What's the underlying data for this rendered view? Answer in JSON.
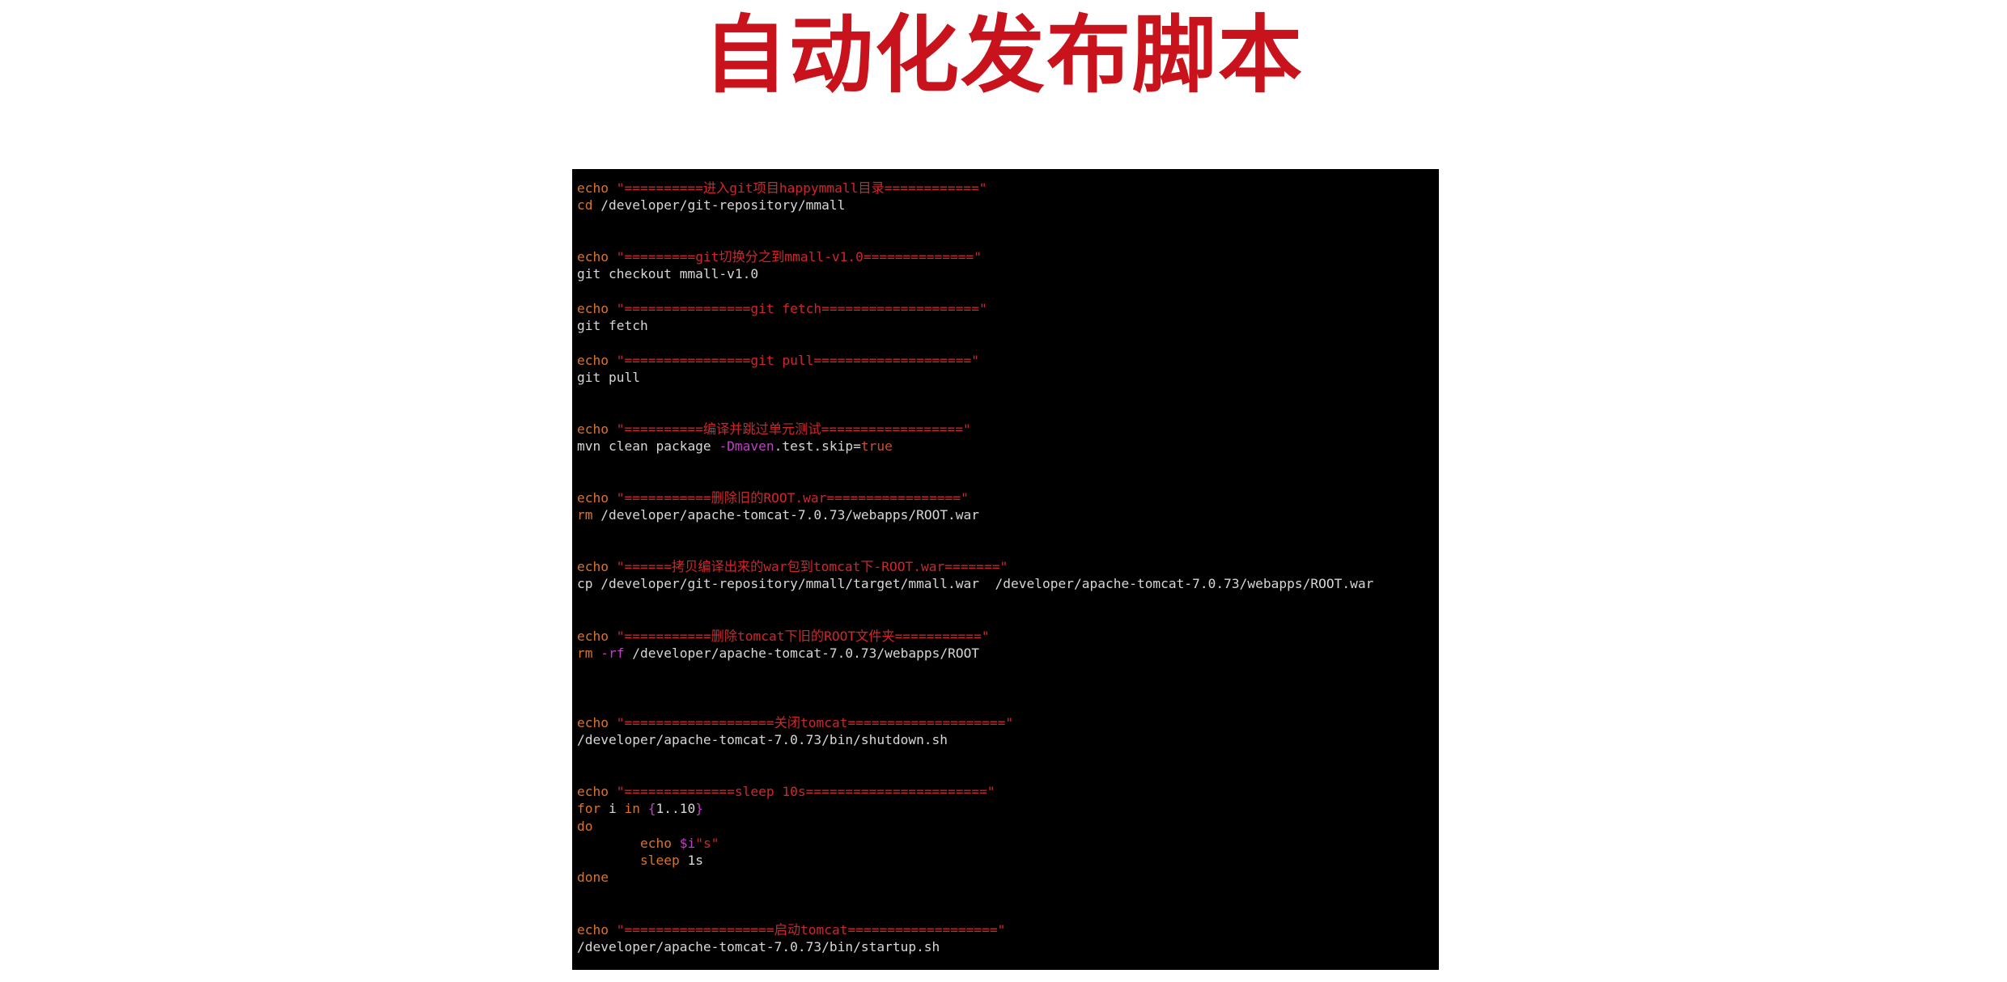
{
  "title": "自动化发布脚本",
  "colors": {
    "title": "#c8131c",
    "terminal_bg": "#000000",
    "plain": "#d6d6d6",
    "keyword": "#d8732c",
    "string": "#d0262b",
    "flag": "#c33ec6",
    "bool": "#c9502e",
    "variable": "#c33ec6"
  },
  "code_lines": [
    [
      {
        "t": "echo ",
        "c": "kw"
      },
      {
        "t": "\"==========进入git项目happymmall目录============\"",
        "c": "str"
      }
    ],
    [
      {
        "t": "cd ",
        "c": "kw"
      },
      {
        "t": "/developer/git-repository/mmall",
        "c": "plain"
      }
    ],
    [
      {
        "t": "echo ",
        "c": "kw"
      },
      {
        "t": "\"=========git切换分之到mmall-v1.0==============\"",
        "c": "str"
      }
    ],
    [
      {
        "t": "git checkout mmall-v1.0",
        "c": "plain"
      }
    ],
    [
      {
        "t": "echo ",
        "c": "kw"
      },
      {
        "t": "\"================git fetch====================\"",
        "c": "str"
      }
    ],
    [
      {
        "t": "git fetch",
        "c": "plain"
      }
    ],
    [
      {
        "t": "echo ",
        "c": "kw"
      },
      {
        "t": "\"================git pull====================\"",
        "c": "str"
      }
    ],
    [
      {
        "t": "git pull",
        "c": "plain"
      }
    ],
    [
      {
        "t": "echo ",
        "c": "kw"
      },
      {
        "t": "\"==========编译并跳过单元测试==================\"",
        "c": "str"
      }
    ],
    [
      {
        "t": "mvn clean package ",
        "c": "plain"
      },
      {
        "t": "-Dmaven",
        "c": "flag"
      },
      {
        "t": ".test.skip=",
        "c": "plain"
      },
      {
        "t": "true",
        "c": "bool"
      }
    ],
    [
      {
        "t": "echo ",
        "c": "kw"
      },
      {
        "t": "\"===========删除旧的ROOT.war=================\"",
        "c": "str"
      }
    ],
    [
      {
        "t": "rm ",
        "c": "kw"
      },
      {
        "t": "/developer/apache-tomcat-7.0.73/webapps/ROOT.war",
        "c": "plain"
      }
    ],
    [
      {
        "t": "echo ",
        "c": "kw"
      },
      {
        "t": "\"======拷贝编译出来的war包到tomcat下-ROOT.war=======\"",
        "c": "str"
      }
    ],
    [
      {
        "t": "cp /developer/git-repository/mmall/target/mmall.war  /developer/apache-tomcat-7.0.73/webapps/ROOT.war",
        "c": "plain"
      }
    ],
    [
      {
        "t": "echo ",
        "c": "kw"
      },
      {
        "t": "\"===========删除tomcat下旧的ROOT文件夹===========\"",
        "c": "str"
      }
    ],
    [
      {
        "t": "rm ",
        "c": "kw"
      },
      {
        "t": "-rf",
        "c": "flag"
      },
      {
        "t": " /developer/apache-tomcat-7.0.73/webapps/ROOT",
        "c": "plain"
      }
    ],
    [
      {
        "t": "echo ",
        "c": "kw"
      },
      {
        "t": "\"===================关闭tomcat====================\"",
        "c": "str"
      }
    ],
    [
      {
        "t": "/developer/apache-tomcat-7.0.73/bin/shutdown.sh",
        "c": "plain"
      }
    ],
    [
      {
        "t": "echo ",
        "c": "kw"
      },
      {
        "t": "\"==============sleep 10s=======================\"",
        "c": "str"
      }
    ],
    [
      {
        "t": "for ",
        "c": "kw"
      },
      {
        "t": "i ",
        "c": "plain"
      },
      {
        "t": "in ",
        "c": "kw"
      },
      {
        "t": "{",
        "c": "flag"
      },
      {
        "t": "1..10",
        "c": "plain"
      },
      {
        "t": "}",
        "c": "flag"
      }
    ],
    [
      {
        "t": "do",
        "c": "kw"
      }
    ],
    [
      {
        "t": "        ",
        "c": "plain"
      },
      {
        "t": "echo ",
        "c": "kw"
      },
      {
        "t": "$i",
        "c": "var"
      },
      {
        "t": "\"s\"",
        "c": "str"
      }
    ],
    [
      {
        "t": "        ",
        "c": "plain"
      },
      {
        "t": "sleep ",
        "c": "kw"
      },
      {
        "t": "1s",
        "c": "plain"
      }
    ],
    [
      {
        "t": "done",
        "c": "kw"
      }
    ],
    [
      {
        "t": "echo ",
        "c": "kw"
      },
      {
        "t": "\"===================启动tomcat===================\"",
        "c": "str"
      }
    ],
    [
      {
        "t": "/developer/apache-tomcat-7.0.73/bin/startup.sh",
        "c": "plain"
      }
    ]
  ]
}
